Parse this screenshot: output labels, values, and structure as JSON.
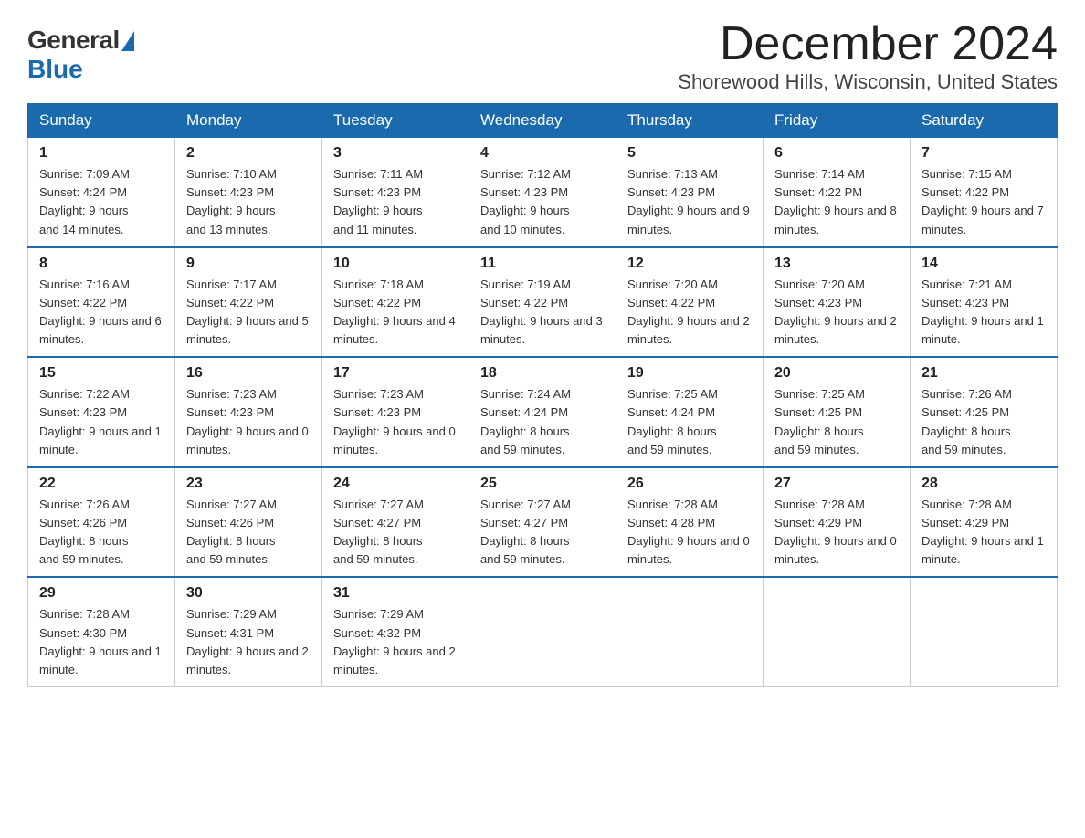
{
  "logo": {
    "general": "General",
    "blue": "Blue"
  },
  "title": "December 2024",
  "location": "Shorewood Hills, Wisconsin, United States",
  "days_of_week": [
    "Sunday",
    "Monday",
    "Tuesday",
    "Wednesday",
    "Thursday",
    "Friday",
    "Saturday"
  ],
  "weeks": [
    [
      {
        "day": "1",
        "sunrise": "7:09 AM",
        "sunset": "4:24 PM",
        "daylight": "9 hours and 14 minutes."
      },
      {
        "day": "2",
        "sunrise": "7:10 AM",
        "sunset": "4:23 PM",
        "daylight": "9 hours and 13 minutes."
      },
      {
        "day": "3",
        "sunrise": "7:11 AM",
        "sunset": "4:23 PM",
        "daylight": "9 hours and 11 minutes."
      },
      {
        "day": "4",
        "sunrise": "7:12 AM",
        "sunset": "4:23 PM",
        "daylight": "9 hours and 10 minutes."
      },
      {
        "day": "5",
        "sunrise": "7:13 AM",
        "sunset": "4:23 PM",
        "daylight": "9 hours and 9 minutes."
      },
      {
        "day": "6",
        "sunrise": "7:14 AM",
        "sunset": "4:22 PM",
        "daylight": "9 hours and 8 minutes."
      },
      {
        "day": "7",
        "sunrise": "7:15 AM",
        "sunset": "4:22 PM",
        "daylight": "9 hours and 7 minutes."
      }
    ],
    [
      {
        "day": "8",
        "sunrise": "7:16 AM",
        "sunset": "4:22 PM",
        "daylight": "9 hours and 6 minutes."
      },
      {
        "day": "9",
        "sunrise": "7:17 AM",
        "sunset": "4:22 PM",
        "daylight": "9 hours and 5 minutes."
      },
      {
        "day": "10",
        "sunrise": "7:18 AM",
        "sunset": "4:22 PM",
        "daylight": "9 hours and 4 minutes."
      },
      {
        "day": "11",
        "sunrise": "7:19 AM",
        "sunset": "4:22 PM",
        "daylight": "9 hours and 3 minutes."
      },
      {
        "day": "12",
        "sunrise": "7:20 AM",
        "sunset": "4:22 PM",
        "daylight": "9 hours and 2 minutes."
      },
      {
        "day": "13",
        "sunrise": "7:20 AM",
        "sunset": "4:23 PM",
        "daylight": "9 hours and 2 minutes."
      },
      {
        "day": "14",
        "sunrise": "7:21 AM",
        "sunset": "4:23 PM",
        "daylight": "9 hours and 1 minute."
      }
    ],
    [
      {
        "day": "15",
        "sunrise": "7:22 AM",
        "sunset": "4:23 PM",
        "daylight": "9 hours and 1 minute."
      },
      {
        "day": "16",
        "sunrise": "7:23 AM",
        "sunset": "4:23 PM",
        "daylight": "9 hours and 0 minutes."
      },
      {
        "day": "17",
        "sunrise": "7:23 AM",
        "sunset": "4:23 PM",
        "daylight": "9 hours and 0 minutes."
      },
      {
        "day": "18",
        "sunrise": "7:24 AM",
        "sunset": "4:24 PM",
        "daylight": "8 hours and 59 minutes."
      },
      {
        "day": "19",
        "sunrise": "7:25 AM",
        "sunset": "4:24 PM",
        "daylight": "8 hours and 59 minutes."
      },
      {
        "day": "20",
        "sunrise": "7:25 AM",
        "sunset": "4:25 PM",
        "daylight": "8 hours and 59 minutes."
      },
      {
        "day": "21",
        "sunrise": "7:26 AM",
        "sunset": "4:25 PM",
        "daylight": "8 hours and 59 minutes."
      }
    ],
    [
      {
        "day": "22",
        "sunrise": "7:26 AM",
        "sunset": "4:26 PM",
        "daylight": "8 hours and 59 minutes."
      },
      {
        "day": "23",
        "sunrise": "7:27 AM",
        "sunset": "4:26 PM",
        "daylight": "8 hours and 59 minutes."
      },
      {
        "day": "24",
        "sunrise": "7:27 AM",
        "sunset": "4:27 PM",
        "daylight": "8 hours and 59 minutes."
      },
      {
        "day": "25",
        "sunrise": "7:27 AM",
        "sunset": "4:27 PM",
        "daylight": "8 hours and 59 minutes."
      },
      {
        "day": "26",
        "sunrise": "7:28 AM",
        "sunset": "4:28 PM",
        "daylight": "9 hours and 0 minutes."
      },
      {
        "day": "27",
        "sunrise": "7:28 AM",
        "sunset": "4:29 PM",
        "daylight": "9 hours and 0 minutes."
      },
      {
        "day": "28",
        "sunrise": "7:28 AM",
        "sunset": "4:29 PM",
        "daylight": "9 hours and 1 minute."
      }
    ],
    [
      {
        "day": "29",
        "sunrise": "7:28 AM",
        "sunset": "4:30 PM",
        "daylight": "9 hours and 1 minute."
      },
      {
        "day": "30",
        "sunrise": "7:29 AM",
        "sunset": "4:31 PM",
        "daylight": "9 hours and 2 minutes."
      },
      {
        "day": "31",
        "sunrise": "7:29 AM",
        "sunset": "4:32 PM",
        "daylight": "9 hours and 2 minutes."
      },
      null,
      null,
      null,
      null
    ]
  ],
  "labels": {
    "sunrise": "Sunrise:",
    "sunset": "Sunset:",
    "daylight": "Daylight:"
  }
}
